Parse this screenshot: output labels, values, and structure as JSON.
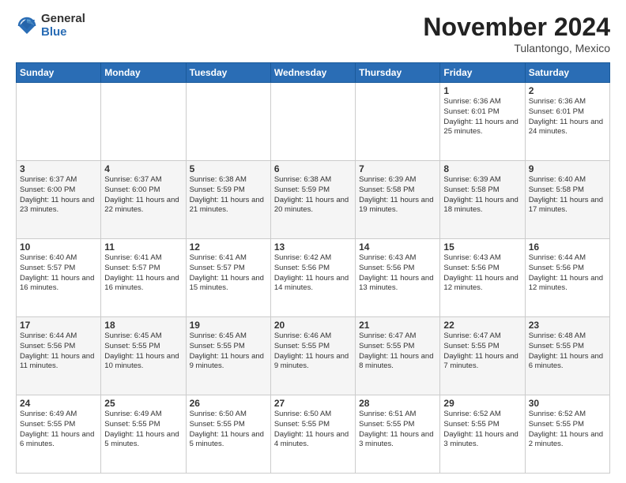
{
  "logo": {
    "general": "General",
    "blue": "Blue"
  },
  "title": "November 2024",
  "subtitle": "Tulantongo, Mexico",
  "headers": [
    "Sunday",
    "Monday",
    "Tuesday",
    "Wednesday",
    "Thursday",
    "Friday",
    "Saturday"
  ],
  "weeks": [
    [
      {
        "day": "",
        "info": ""
      },
      {
        "day": "",
        "info": ""
      },
      {
        "day": "",
        "info": ""
      },
      {
        "day": "",
        "info": ""
      },
      {
        "day": "",
        "info": ""
      },
      {
        "day": "1",
        "info": "Sunrise: 6:36 AM\nSunset: 6:01 PM\nDaylight: 11 hours\nand 25 minutes."
      },
      {
        "day": "2",
        "info": "Sunrise: 6:36 AM\nSunset: 6:01 PM\nDaylight: 11 hours\nand 24 minutes."
      }
    ],
    [
      {
        "day": "3",
        "info": "Sunrise: 6:37 AM\nSunset: 6:00 PM\nDaylight: 11 hours\nand 23 minutes."
      },
      {
        "day": "4",
        "info": "Sunrise: 6:37 AM\nSunset: 6:00 PM\nDaylight: 11 hours\nand 22 minutes."
      },
      {
        "day": "5",
        "info": "Sunrise: 6:38 AM\nSunset: 5:59 PM\nDaylight: 11 hours\nand 21 minutes."
      },
      {
        "day": "6",
        "info": "Sunrise: 6:38 AM\nSunset: 5:59 PM\nDaylight: 11 hours\nand 20 minutes."
      },
      {
        "day": "7",
        "info": "Sunrise: 6:39 AM\nSunset: 5:58 PM\nDaylight: 11 hours\nand 19 minutes."
      },
      {
        "day": "8",
        "info": "Sunrise: 6:39 AM\nSunset: 5:58 PM\nDaylight: 11 hours\nand 18 minutes."
      },
      {
        "day": "9",
        "info": "Sunrise: 6:40 AM\nSunset: 5:58 PM\nDaylight: 11 hours\nand 17 minutes."
      }
    ],
    [
      {
        "day": "10",
        "info": "Sunrise: 6:40 AM\nSunset: 5:57 PM\nDaylight: 11 hours\nand 16 minutes."
      },
      {
        "day": "11",
        "info": "Sunrise: 6:41 AM\nSunset: 5:57 PM\nDaylight: 11 hours\nand 16 minutes."
      },
      {
        "day": "12",
        "info": "Sunrise: 6:41 AM\nSunset: 5:57 PM\nDaylight: 11 hours\nand 15 minutes."
      },
      {
        "day": "13",
        "info": "Sunrise: 6:42 AM\nSunset: 5:56 PM\nDaylight: 11 hours\nand 14 minutes."
      },
      {
        "day": "14",
        "info": "Sunrise: 6:43 AM\nSunset: 5:56 PM\nDaylight: 11 hours\nand 13 minutes."
      },
      {
        "day": "15",
        "info": "Sunrise: 6:43 AM\nSunset: 5:56 PM\nDaylight: 11 hours\nand 12 minutes."
      },
      {
        "day": "16",
        "info": "Sunrise: 6:44 AM\nSunset: 5:56 PM\nDaylight: 11 hours\nand 12 minutes."
      }
    ],
    [
      {
        "day": "17",
        "info": "Sunrise: 6:44 AM\nSunset: 5:56 PM\nDaylight: 11 hours\nand 11 minutes."
      },
      {
        "day": "18",
        "info": "Sunrise: 6:45 AM\nSunset: 5:55 PM\nDaylight: 11 hours\nand 10 minutes."
      },
      {
        "day": "19",
        "info": "Sunrise: 6:45 AM\nSunset: 5:55 PM\nDaylight: 11 hours\nand 9 minutes."
      },
      {
        "day": "20",
        "info": "Sunrise: 6:46 AM\nSunset: 5:55 PM\nDaylight: 11 hours\nand 9 minutes."
      },
      {
        "day": "21",
        "info": "Sunrise: 6:47 AM\nSunset: 5:55 PM\nDaylight: 11 hours\nand 8 minutes."
      },
      {
        "day": "22",
        "info": "Sunrise: 6:47 AM\nSunset: 5:55 PM\nDaylight: 11 hours\nand 7 minutes."
      },
      {
        "day": "23",
        "info": "Sunrise: 6:48 AM\nSunset: 5:55 PM\nDaylight: 11 hours\nand 6 minutes."
      }
    ],
    [
      {
        "day": "24",
        "info": "Sunrise: 6:49 AM\nSunset: 5:55 PM\nDaylight: 11 hours\nand 6 minutes."
      },
      {
        "day": "25",
        "info": "Sunrise: 6:49 AM\nSunset: 5:55 PM\nDaylight: 11 hours\nand 5 minutes."
      },
      {
        "day": "26",
        "info": "Sunrise: 6:50 AM\nSunset: 5:55 PM\nDaylight: 11 hours\nand 5 minutes."
      },
      {
        "day": "27",
        "info": "Sunrise: 6:50 AM\nSunset: 5:55 PM\nDaylight: 11 hours\nand 4 minutes."
      },
      {
        "day": "28",
        "info": "Sunrise: 6:51 AM\nSunset: 5:55 PM\nDaylight: 11 hours\nand 3 minutes."
      },
      {
        "day": "29",
        "info": "Sunrise: 6:52 AM\nSunset: 5:55 PM\nDaylight: 11 hours\nand 3 minutes."
      },
      {
        "day": "30",
        "info": "Sunrise: 6:52 AM\nSunset: 5:55 PM\nDaylight: 11 hours\nand 2 minutes."
      }
    ]
  ]
}
